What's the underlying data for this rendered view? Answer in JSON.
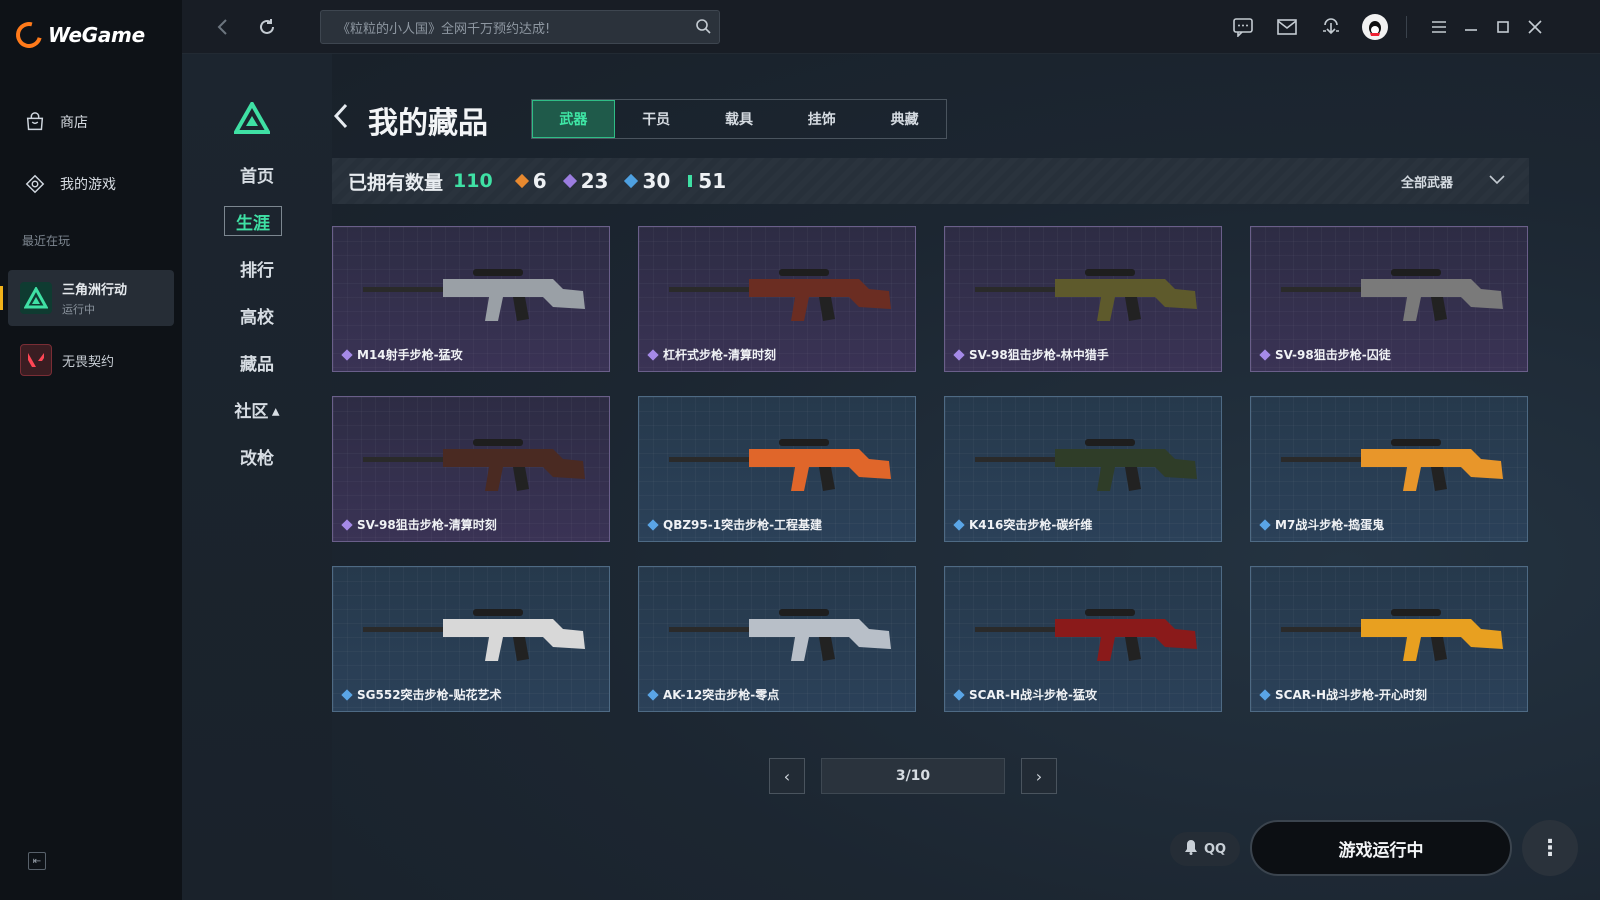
{
  "app": {
    "logo_text": "WeGame",
    "nav": [
      {
        "label": "商店",
        "icon": "shop-bag-icon"
      },
      {
        "label": "我的游戏",
        "icon": "games-icon"
      }
    ],
    "recent_label": "最近在玩",
    "recent_games": [
      {
        "name": "三角洲行动",
        "status": "运行中",
        "icon": "delta-force-icon"
      },
      {
        "name": "无畏契约",
        "status": "",
        "icon": "valorant-icon"
      }
    ]
  },
  "topbar": {
    "search_placeholder": "《粒粒的小人国》全网千万预约达成!",
    "icons": [
      "back-icon",
      "refresh-icon",
      "search-icon",
      "chat-icon",
      "mail-icon",
      "download-icon",
      "avatar",
      "menu-icon",
      "minimize-icon",
      "maximize-icon",
      "close-icon"
    ]
  },
  "game_nav": {
    "items": [
      "首页",
      "生涯",
      "排行",
      "高校",
      "藏品",
      "社区",
      "改枪"
    ],
    "active": "生涯"
  },
  "page": {
    "title": "我的藏品",
    "tabs": [
      "武器",
      "干员",
      "载具",
      "挂饰",
      "典藏"
    ],
    "active_tab": "武器",
    "owned_label": "已拥有数量",
    "owned_count": "110",
    "rarity_counts": [
      {
        "count": "6",
        "color": "#e8892f"
      },
      {
        "count": "23",
        "color": "#9b7de0"
      },
      {
        "count": "30",
        "color": "#4ea0e0"
      },
      {
        "count": "51",
        "color": "#3fe0a4"
      }
    ],
    "filter_label": "全部武器"
  },
  "items": [
    {
      "name": "M14射手步枪-猛攻",
      "rarity": "purple",
      "gun_color": "#9aa0a6"
    },
    {
      "name": "杠杆式步枪-清算时刻",
      "rarity": "purple",
      "gun_color": "#6b2d22"
    },
    {
      "name": "SV-98狙击步枪-林中猎手",
      "rarity": "purple",
      "gun_color": "#5e5a2c"
    },
    {
      "name": "SV-98狙击步枪-囚徒",
      "rarity": "purple",
      "gun_color": "#7a7a7a"
    },
    {
      "name": "SV-98狙击步枪-清算时刻",
      "rarity": "purple",
      "gun_color": "#4a2a22"
    },
    {
      "name": "QBZ95-1突击步枪-工程基建",
      "rarity": "blue",
      "gun_color": "#e0662a"
    },
    {
      "name": "K416突击步枪-碳纤维",
      "rarity": "blue",
      "gun_color": "#2f3d28"
    },
    {
      "name": "M7战斗步枪-捣蛋鬼",
      "rarity": "blue",
      "gun_color": "#e8962a"
    },
    {
      "name": "SG552突击步枪-贴花艺术",
      "rarity": "blue",
      "gun_color": "#d8d8d8"
    },
    {
      "name": "AK-12突击步枪-零点",
      "rarity": "blue",
      "gun_color": "#b8bfc8"
    },
    {
      "name": "SCAR-H战斗步枪-猛攻",
      "rarity": "blue",
      "gun_color": "#8a1a1a"
    },
    {
      "name": "SCAR-H战斗步枪-开心时刻",
      "rarity": "blue",
      "gun_color": "#e8a020"
    }
  ],
  "pager": {
    "display": "3/10"
  },
  "bottom": {
    "qq_label": "QQ",
    "launch_label": "游戏运行中"
  }
}
